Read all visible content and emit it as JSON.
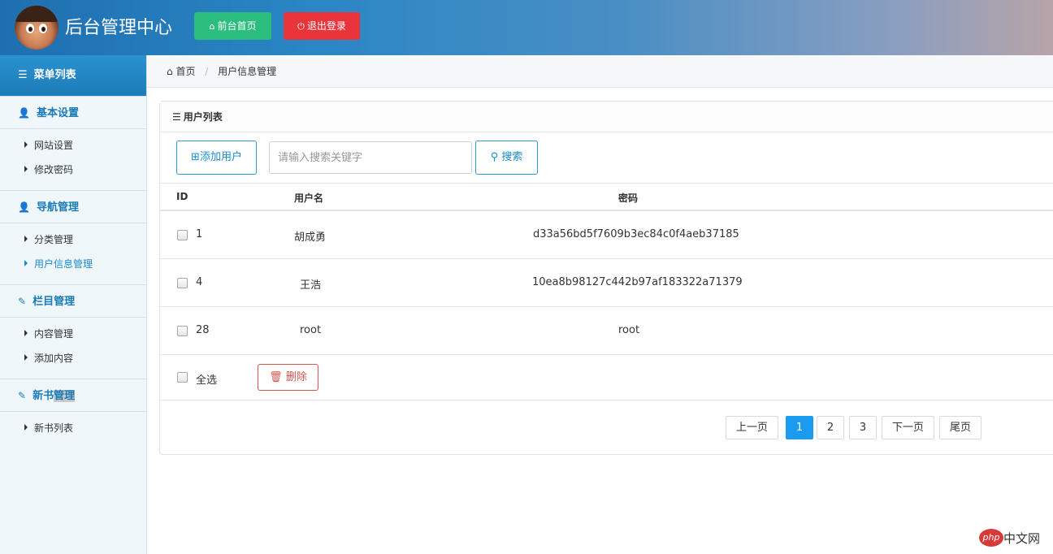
{
  "header": {
    "title": "后台管理中心",
    "front_btn": "前台首页",
    "logout_btn": "退出登录",
    "front_color": "#2bbd7e",
    "logout_color": "#e8343a"
  },
  "sidebar": {
    "head": "菜单列表",
    "groups": [
      {
        "title": "基本设置",
        "icon": "user-icon",
        "items": [
          "网站设置",
          "修改密码"
        ]
      },
      {
        "title": "导航管理",
        "icon": "user-icon",
        "items": [
          "分类管理",
          "用户信息管理"
        ]
      },
      {
        "title": "栏目管理",
        "icon": "edit-icon",
        "items": [
          "内容管理",
          "添加内容"
        ]
      },
      {
        "title_a": "新书",
        "title_b": "管理",
        "icon": "edit-icon",
        "items": [
          "新书列表"
        ]
      }
    ],
    "active_item": "用户信息管理"
  },
  "breadcrumb": {
    "home": "首页",
    "current": "用户信息管理"
  },
  "panel": {
    "title": "用户列表",
    "add_btn": "添加用户",
    "search_placeholder": "请输入搜索关键字",
    "search_btn": "搜索"
  },
  "table": {
    "headers": {
      "id": "ID",
      "username": "用户名",
      "password": "密码"
    },
    "rows": [
      {
        "id": "1",
        "username": "胡成勇",
        "password": "d33a56bd5f7609b3ec84c0f4aeb37185"
      },
      {
        "id": "4",
        "username": "王浩",
        "password": "10ea8b98127c442b97af183322a71379"
      },
      {
        "id": "28",
        "username": "root",
        "password": "root"
      }
    ],
    "select_all": "全选",
    "delete_btn": "删除"
  },
  "pagination": {
    "prev": "上一页",
    "pages": [
      "1",
      "2",
      "3"
    ],
    "current": "1",
    "next": "下一页",
    "last": "尾页"
  },
  "watermark": {
    "badge": "php",
    "text": "中文网"
  }
}
